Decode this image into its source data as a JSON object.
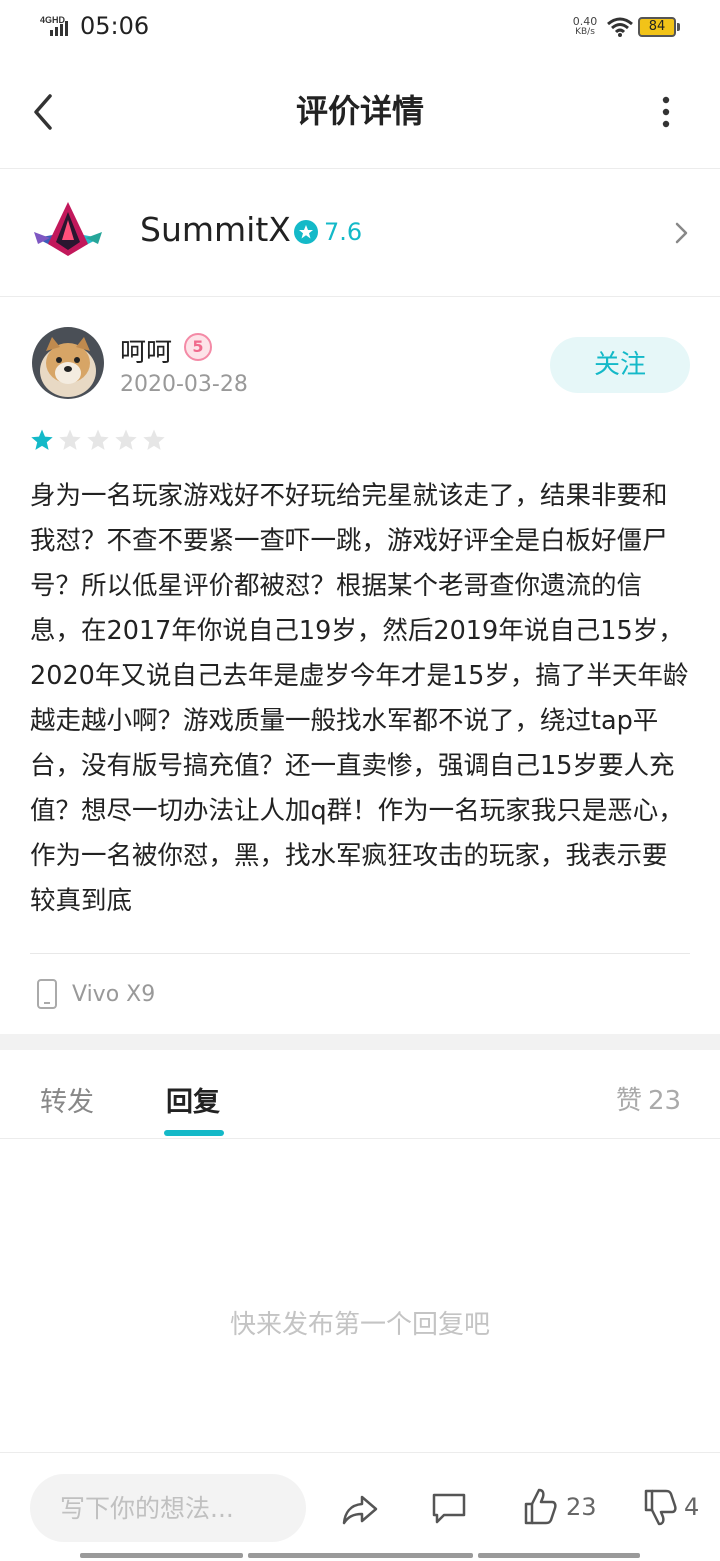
{
  "status_bar": {
    "network": "4GHD",
    "time": "05:06",
    "speed_value": "0.40",
    "speed_unit": "KB/s",
    "battery": "84"
  },
  "header": {
    "title": "评价详情"
  },
  "app": {
    "name": "SummitX",
    "score": "7.6"
  },
  "review": {
    "author": "呵呵",
    "badge": "5",
    "date": "2020-03-28",
    "follow_label": "关注",
    "rating": 1,
    "rating_max": 5,
    "text": "身为一名玩家游戏好不好玩给完星就该走了，结果非要和我怼？不查不要紧一查吓一跳，游戏好评全是白板好僵尸号？所以低星评价都被怼？根据某个老哥查你遗流的信息，在2017年你说自己19岁，然后2019年说自己15岁，2020年又说自己去年是虚岁今年才是15岁，搞了半天年龄越走越小啊？游戏质量一般找水军都不说了，绕过tap平台，没有版号搞充值？还一直卖惨，强调自己15岁要人充值？想尽一切办法让人加q群！作为一名玩家我只是恶心，作为一名被你怼，黑，找水军疯狂攻击的玩家，我表示要较真到底",
    "device": "Vivo X9"
  },
  "tabs": {
    "forward": "转发",
    "reply": "回复",
    "likes_label": "赞",
    "likes_count": "23"
  },
  "empty_state": "快来发布第一个回复吧",
  "bottom_bar": {
    "input_placeholder": "写下你的想法...",
    "like_count": "23",
    "dislike_count": "4"
  },
  "colors": {
    "accent": "#14b9c8",
    "battery": "#f2c318",
    "badge": "#f06a8c"
  },
  "icons": [
    "back-icon",
    "more-icon",
    "score-star-icon",
    "chevron-right-icon",
    "phone-icon",
    "share-icon",
    "comment-icon",
    "thumbs-up-icon",
    "thumbs-down-icon"
  ]
}
